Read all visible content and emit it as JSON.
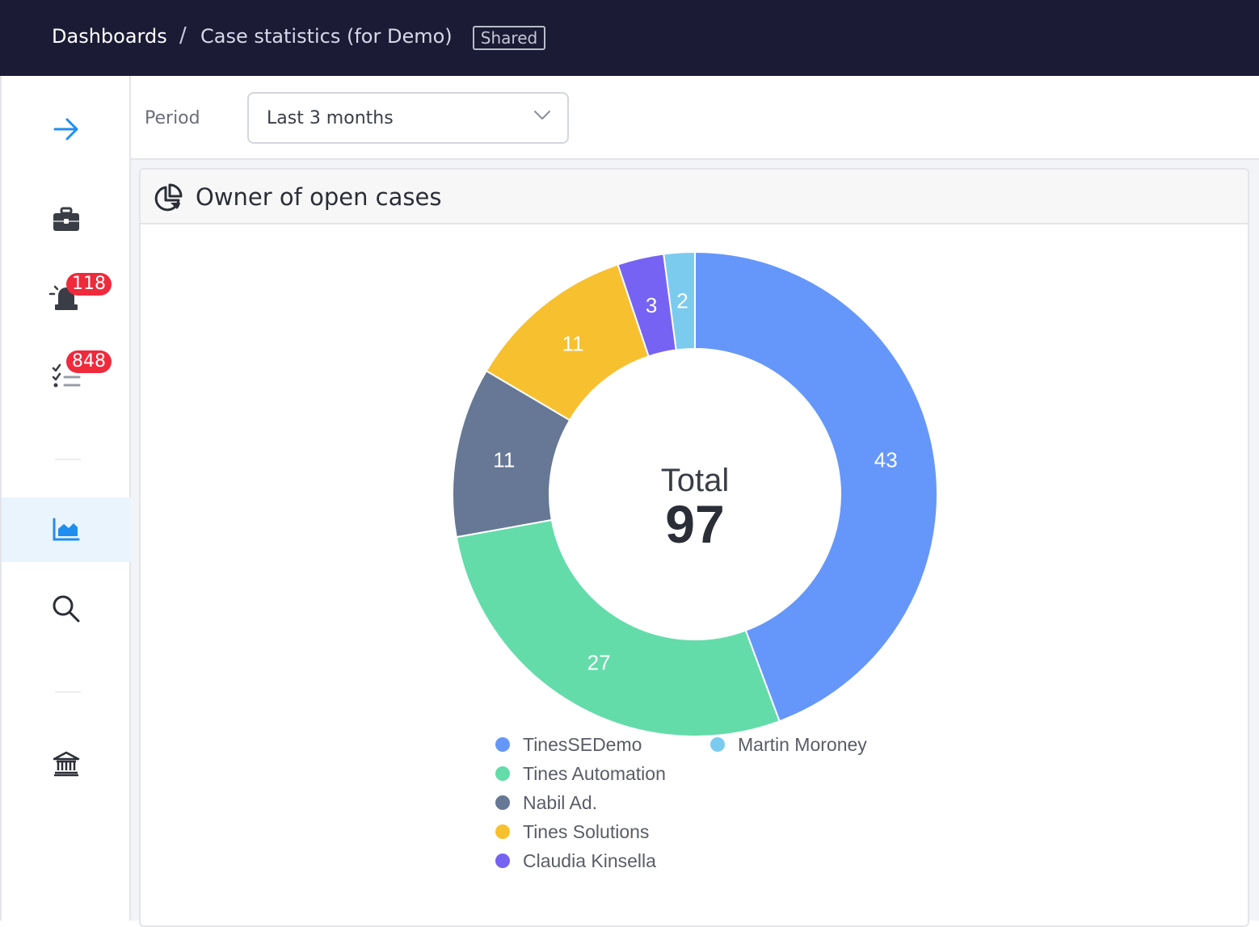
{
  "breadcrumb": {
    "root": "Dashboards",
    "separator": "/",
    "current": "Case statistics (for Demo)",
    "badge": "Shared"
  },
  "sidebar": {
    "items": [
      {
        "name": "expand",
        "icon": "arrow-right-icon"
      },
      {
        "name": "cases",
        "icon": "briefcase-icon"
      },
      {
        "name": "alerts",
        "icon": "siren-icon",
        "badge": "118"
      },
      {
        "name": "tasks",
        "icon": "checklist-icon",
        "badge": "848"
      },
      {
        "name": "dashboards",
        "icon": "area-chart-icon",
        "active": true
      },
      {
        "name": "search",
        "icon": "search-icon"
      },
      {
        "name": "admin",
        "icon": "bank-icon"
      }
    ]
  },
  "filter": {
    "period_label": "Period",
    "period_value": "Last 3 months"
  },
  "card": {
    "title": "Owner of open cases"
  },
  "colors": {
    "accent": "#1f8ef1",
    "badge": "#ef2a3b",
    "topbar": "#1b1b35"
  },
  "chart_data": {
    "type": "pie",
    "donut": true,
    "center_label": "Total",
    "center_value": "97",
    "slices": [
      {
        "name": "TinesSEDemo",
        "value": 43,
        "color": "#6597fa"
      },
      {
        "name": "Tines Automation",
        "value": 27,
        "color": "#63dcaa"
      },
      {
        "name": "Nabil Ad.",
        "value": 11,
        "color": "#667895"
      },
      {
        "name": "Tines Solutions",
        "value": 11,
        "color": "#f7c02f"
      },
      {
        "name": "Claudia Kinsella",
        "value": 3,
        "color": "#7663f3"
      },
      {
        "name": "Martin Moroney",
        "value": 2,
        "color": "#7bcbef"
      }
    ],
    "legend_position": "bottom"
  }
}
